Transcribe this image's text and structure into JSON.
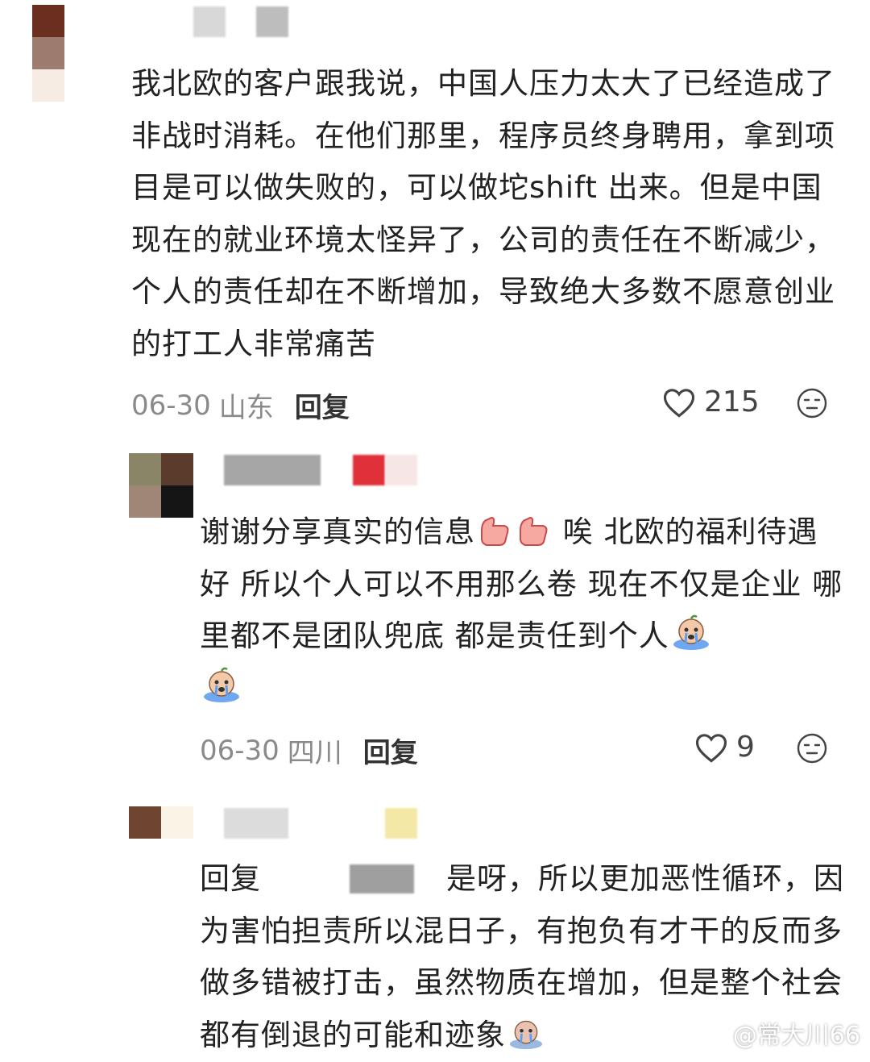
{
  "comments": [
    {
      "text": "我北欧的客户跟我说，中国人压力太大了已经造成了非战时消耗。在他们那里，程序员终身聘用，拿到项目是可以做失败的，可以做坨shift 出来。但是中国现在的就业环境太怪异了，公司的责任在不断减少，个人的责任却在不断增加，导致绝大多数不愿意创业的打工人非常痛苦",
      "date": "06-30",
      "location": "山东",
      "reply_label": "回复",
      "likes": "215"
    },
    {
      "text_part1": "谢谢分享真实的信息",
      "text_part2": " 唉 北欧的福利待遇好 所以个人可以不用那么卷 现在不仅是企业 哪里都不是团队兜底 都是责任到个人",
      "date": "06-30",
      "location": "四川",
      "reply_label": "回复",
      "likes": "9"
    },
    {
      "reply_prefix": "回复",
      "text": "是呀，所以更加恶性循环，因为害怕担责所以混日子，有抱负有才干的反而多做多错被打击，虽然物质在增加，但是整个社会都有倒退的可能和迹象"
    }
  ],
  "watermark": "@常大川66",
  "colors": {
    "text": "#222222",
    "meta": "#8a8a8a",
    "background": "#ffffff"
  }
}
